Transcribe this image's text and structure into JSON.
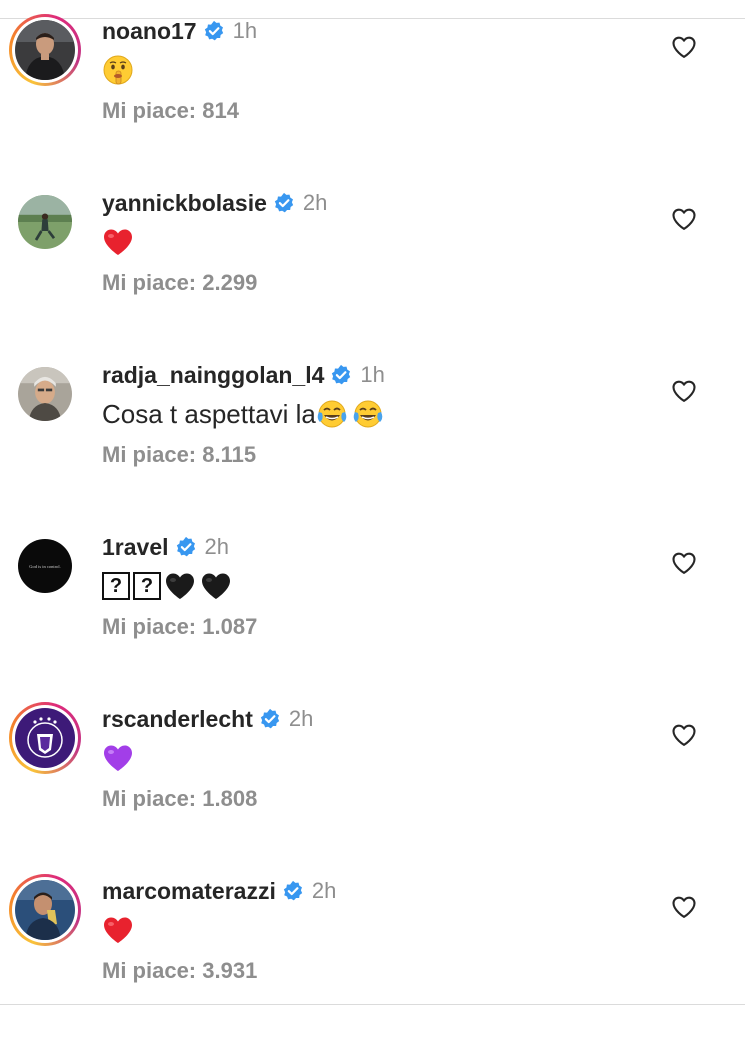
{
  "comments": [
    {
      "username": "noano17",
      "time": "1h",
      "text": "",
      "text_emoji": [
        "shushing-face"
      ],
      "likes_label": "Mi piace: 814",
      "verified": true,
      "story_ring": true
    },
    {
      "username": "yannickbolasie",
      "time": "2h",
      "text": "",
      "text_emoji": [
        "red-heart"
      ],
      "likes_label": "Mi piace: 2.299",
      "verified": true,
      "story_ring": false
    },
    {
      "username": "radja_nainggolan_l4",
      "time": "1h",
      "text": "Cosa t aspettavi la",
      "text_emoji": [
        "tears-of-joy",
        "tears-of-joy"
      ],
      "likes_label": "Mi piace: 8.115",
      "verified": true,
      "story_ring": false
    },
    {
      "username": "1ravel",
      "time": "2h",
      "text": "",
      "text_emoji": [
        "replacement-char",
        "replacement-char",
        "black-heart",
        "black-heart"
      ],
      "avatar_text": "God is in control.",
      "likes_label": "Mi piace: 1.087",
      "verified": true,
      "story_ring": false
    },
    {
      "username": "rscanderlecht",
      "time": "2h",
      "text": "",
      "text_emoji": [
        "purple-heart"
      ],
      "likes_label": "Mi piace: 1.808",
      "verified": true,
      "story_ring": true
    },
    {
      "username": "marcomaterazzi",
      "time": "2h",
      "text": "",
      "text_emoji": [
        "red-heart"
      ],
      "likes_label": "Mi piace: 3.931",
      "verified": true,
      "story_ring": true
    }
  ],
  "colors": {
    "verified_blue": "#3897f0",
    "muted_text": "#8e8e8e",
    "primary_text": "#262626",
    "divider": "#dbdbdb"
  }
}
